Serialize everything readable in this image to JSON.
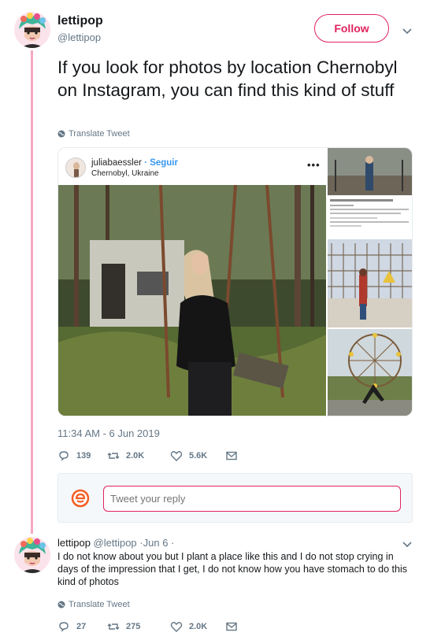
{
  "tweet": {
    "author_name": "lettipop",
    "author_handle": "@lettipop",
    "follow_label": "Follow",
    "text": "If you look for photos by location Chernobyl on Instagram, you can find this kind of stuff",
    "translate_label": "Translate Tweet",
    "timestamp": "11:34 AM - 6 Jun 2019",
    "stats": {
      "replies": "139",
      "retweets": "2.0K",
      "likes": "5.6K"
    }
  },
  "embedded_post": {
    "username": "juliabaessler",
    "separator": "·",
    "follow_label": "Seguir",
    "location": "Chernobyl, Ukraine",
    "more": "•••"
  },
  "reply_box": {
    "placeholder": "Tweet your reply"
  },
  "reply": {
    "author_name": "lettipop",
    "author_handle": "@lettipop",
    "date": "·Jun 6 ·",
    "text": "I do not know about you but I plant a place like this and I do not stop crying in days of the impression that I get, I do not know how you have stomach to do this kind of photos",
    "translate_label": "Translate Tweet",
    "stats": {
      "replies": "27",
      "retweets": "275",
      "likes": "2.0K"
    }
  },
  "colors": {
    "accent": "#e0245e",
    "thread": "#f4a8c4",
    "muted": "#657786",
    "ig_blue": "#3897f0"
  },
  "icons": [
    "caret-down-icon",
    "globe-icon",
    "reply-icon",
    "retweet-icon",
    "like-icon",
    "message-icon"
  ]
}
